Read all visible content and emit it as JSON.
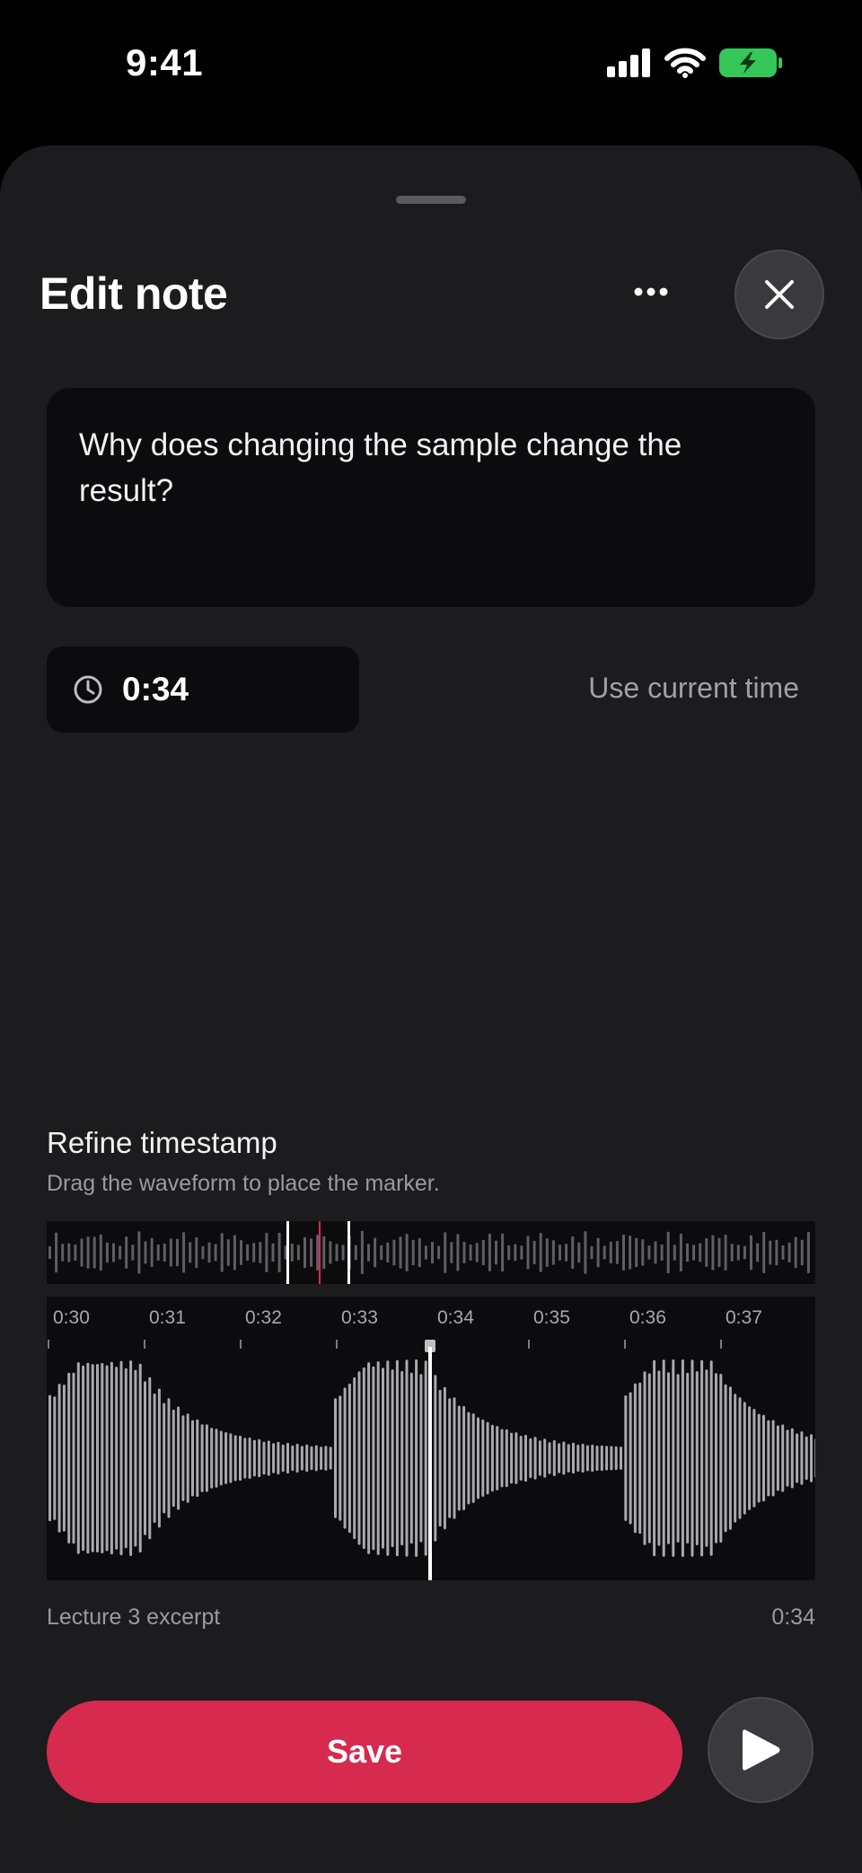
{
  "status_bar": {
    "time": "9:41",
    "icons": [
      "cellular-signal-icon",
      "wifi-icon",
      "battery-charging-icon"
    ],
    "battery_color": "#34c759"
  },
  "sheet": {
    "title": "Edit note",
    "more_icon": "ellipsis-icon",
    "close_icon": "close-icon"
  },
  "note": {
    "text": "Why does changing the sample change the result?"
  },
  "timestamp": {
    "icon": "clock-icon",
    "value": "0:34",
    "use_current_label": "Use current time"
  },
  "refine": {
    "title": "Refine timestamp",
    "subtitle": "Drag the waveform to place the marker.",
    "tick_labels": [
      "0:30",
      "0:31",
      "0:32",
      "0:33",
      "0:34",
      "0:35",
      "0:36",
      "0:37"
    ],
    "marker_time": "0:34"
  },
  "track": {
    "name": "Lecture 3 excerpt",
    "time": "0:34"
  },
  "actions": {
    "save_label": "Save",
    "play_icon": "play-icon"
  },
  "colors": {
    "accent": "#d72a4f",
    "background": "#1c1c1f",
    "field": "#0c0c0e"
  }
}
